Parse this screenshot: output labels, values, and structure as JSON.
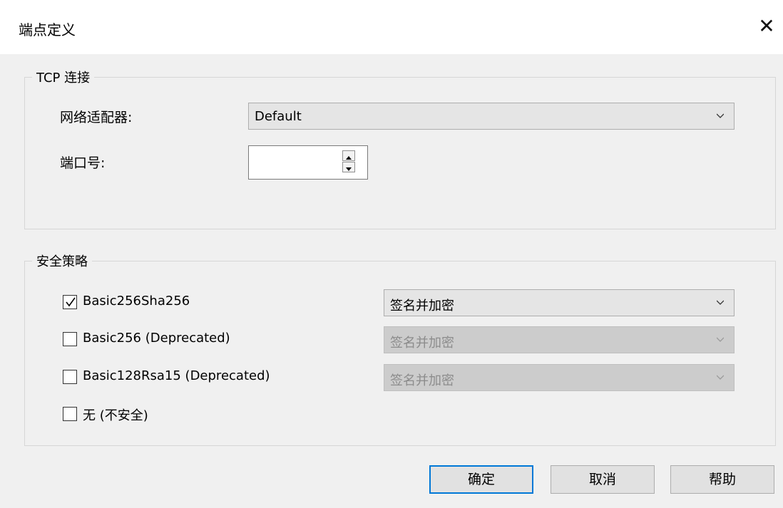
{
  "dialog": {
    "title": "端点定义"
  },
  "tcp": {
    "legend": "TCP 连接",
    "adapter_label": "网络适配器:",
    "adapter_value": "Default",
    "port_label": "端口号:",
    "port_value": ""
  },
  "security": {
    "legend": "安全策略",
    "policies": [
      {
        "name": "Basic256Sha256",
        "checked": true,
        "mode": "签名并加密",
        "enabled": true
      },
      {
        "name": "Basic256 (Deprecated)",
        "checked": false,
        "mode": "签名并加密",
        "enabled": false
      },
      {
        "name": "Basic128Rsa15 (Deprecated)",
        "checked": false,
        "mode": "签名并加密",
        "enabled": false
      },
      {
        "name": "无 (不安全)",
        "checked": false
      }
    ]
  },
  "buttons": {
    "ok": "确定",
    "cancel": "取消",
    "help": "帮助"
  },
  "colors": {
    "accent": "#0078d7",
    "dialog_bg": "#f0f0f0",
    "combo_bg": "#e5e5e5"
  }
}
